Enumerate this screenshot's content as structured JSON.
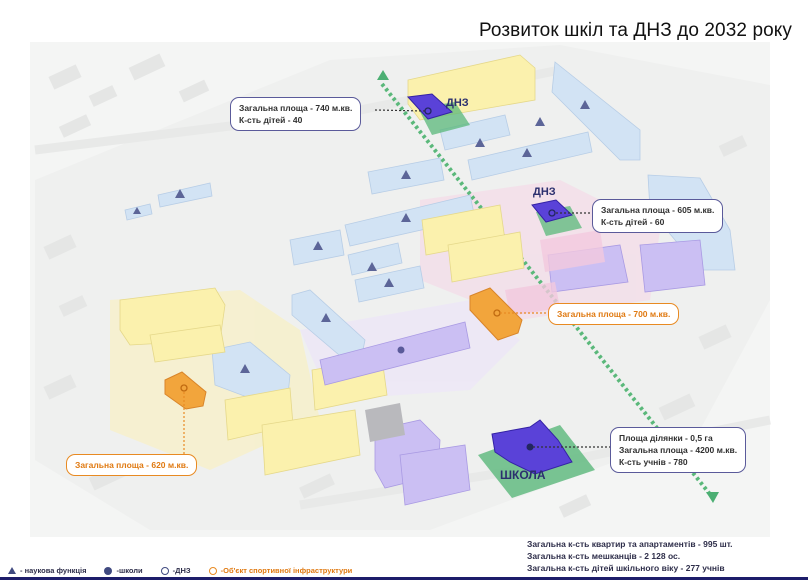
{
  "title": "Розвиток шкіл та ДНЗ до 2032 року",
  "callouts": {
    "dnz1": [
      "Загальна площа - 740 м.кв.",
      "К-сть дітей - 40"
    ],
    "dnz2": [
      "Загальна площа - 605 м.кв.",
      "К-сть дітей - 60"
    ],
    "sport1": "Загальна площа - 700 м.кв.",
    "sport2": "Загальна площа - 620 м.кв.",
    "school": [
      "Площа ділянки - 0,5 га",
      "Загальна площа - 4200 м.кв.",
      "К-сть учнів - 780"
    ]
  },
  "labels": {
    "dnz1": "ДНЗ",
    "dnz2": "ДНЗ",
    "school": "ШКОЛА"
  },
  "stats": [
    "Загальна к-сть квартир та апартаментів - 995 шт.",
    "Загальна к-сть мешканців - 2 128 ос.",
    "Загальна к-сть дітей шкільного віку - 277 учнів"
  ],
  "legend": [
    {
      "icon": "triangle-icon",
      "label": "- наукова функція"
    },
    {
      "icon": "filled-circle-icon",
      "label": "-школи"
    },
    {
      "icon": "ring-icon",
      "label": "-ДНЗ"
    },
    {
      "icon": "orange-ring-icon",
      "label": "-Об'єкт спортивної інфраструктури"
    }
  ],
  "colors": {
    "school": "#5a42d8",
    "sport": "#f2a53c",
    "residential_blue": "#cfe1f3",
    "residential_yellow": "#fbf3b4",
    "residential_purple": "#c9bdf0",
    "green_axis": "#5ab87a"
  }
}
